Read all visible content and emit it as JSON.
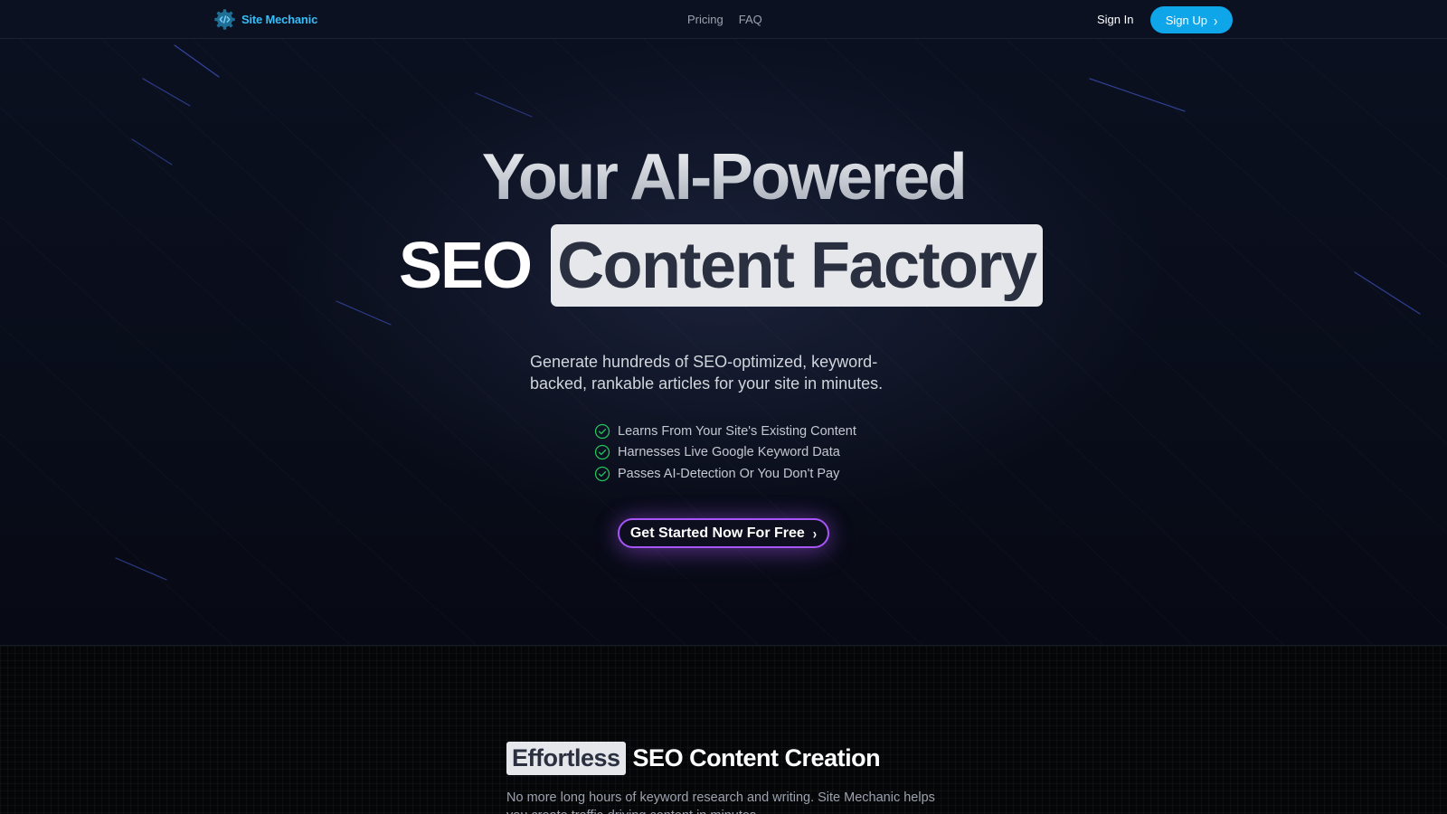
{
  "nav": {
    "brand_name": "Site Mechanic",
    "links": [
      "Pricing",
      "FAQ"
    ],
    "sign_in": "Sign In",
    "sign_up": "Sign Up"
  },
  "hero": {
    "title_line1": "Your AI-Powered",
    "title_line2_plain": "SEO",
    "title_line2_highlight": "Content Factory",
    "subtitle": "Generate hundreds of SEO-optimized, keyword-backed, rankable articles for your site in minutes.",
    "features": [
      "Learns From Your Site's Existing Content",
      "Harnesses Live Google Keyword Data",
      "Passes AI-Detection Or You Don't Pay"
    ],
    "cta": "Get Started Now For Free"
  },
  "section2": {
    "heading_highlight": "Effortless",
    "heading_rest": "SEO Content Creation",
    "description": "No more long hours of keyword research and writing. Site Mechanic helps you create traffic-driving content in minutes."
  },
  "colors": {
    "brand": "#38bdf8",
    "signup_bg": "#0ea5e9",
    "cta_border": "#a855f7",
    "check": "#22c55e"
  },
  "icons": {
    "brand": "gear-code-icon",
    "signup": "chevron-right-icon",
    "features": "check-circle-icon",
    "cta": "chevron-right-icon"
  }
}
